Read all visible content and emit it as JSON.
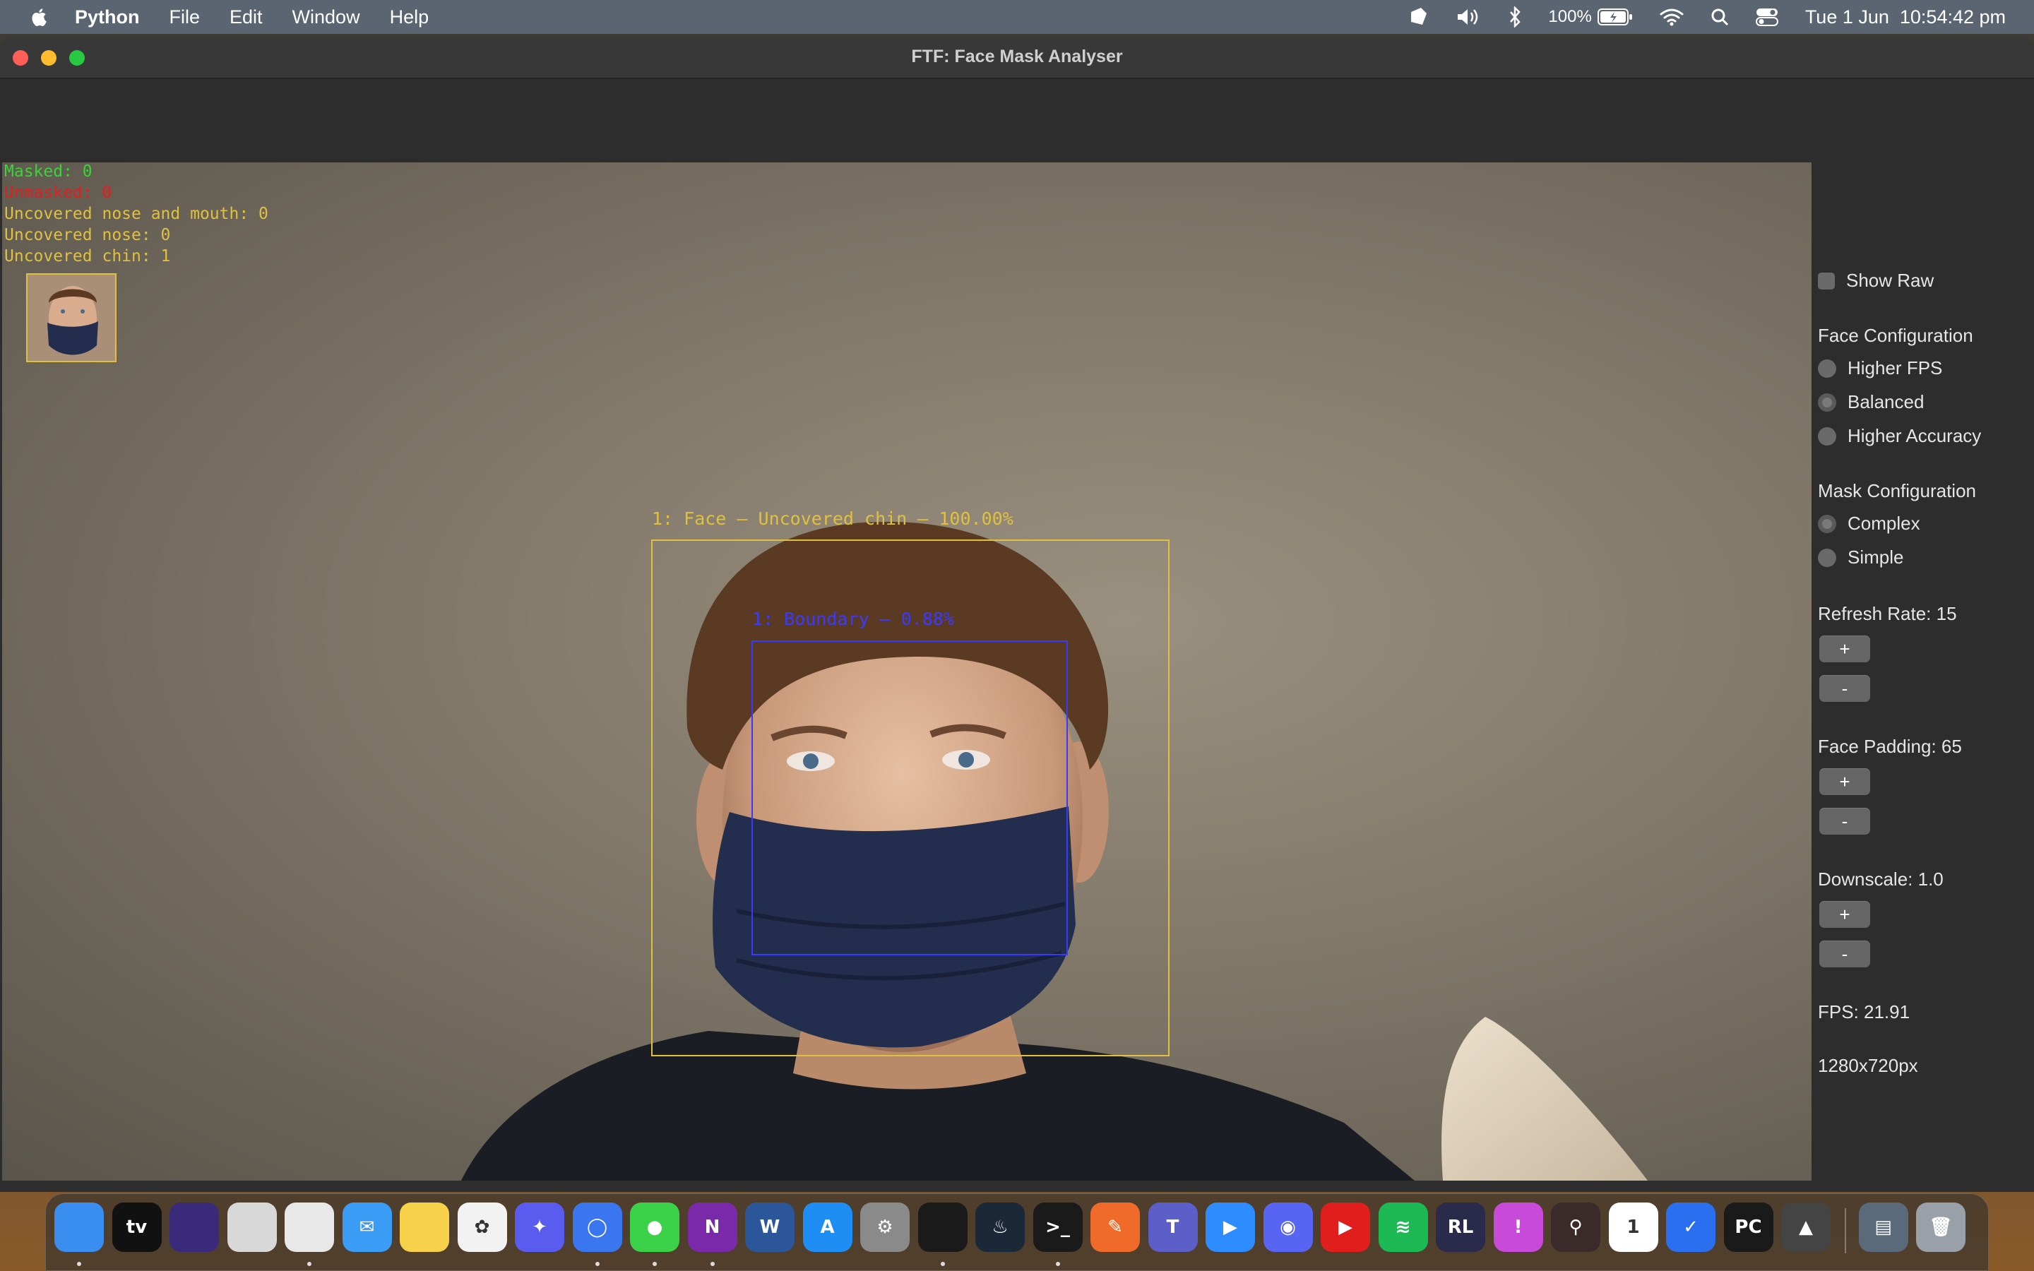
{
  "menubar": {
    "app_name": "Python",
    "menus": [
      "File",
      "Edit",
      "Window",
      "Help"
    ],
    "battery": "100%",
    "clock": "Tue 1 Jun  10:54:42 pm"
  },
  "window": {
    "title": "FTF: Face Mask Analyser"
  },
  "overlay": {
    "masked": "Masked: 0",
    "unmasked": "Unmasked: 0",
    "uncovered_nose_mouth": "Uncovered nose and mouth: 0",
    "uncovered_nose": "Uncovered nose: 0",
    "uncovered_chin": "Uncovered chin: 1",
    "face_label": "1: Face — Uncovered chin — 100.00%",
    "boundary_label": "1: Boundary — 0.88%",
    "colors": {
      "masked": "#3bd23b",
      "unmasked": "#e02020",
      "warning": "#e0c040",
      "boundary": "#3a3aff"
    }
  },
  "panel": {
    "show_raw": "Show Raw",
    "face_config_title": "Face Configuration",
    "face_options": [
      "Higher FPS",
      "Balanced",
      "Higher Accuracy"
    ],
    "face_selected": "Balanced",
    "mask_config_title": "Mask Configuration",
    "mask_options": [
      "Complex",
      "Simple"
    ],
    "mask_selected": "Complex",
    "refresh_rate": "Refresh Rate: 15",
    "face_padding": "Face Padding: 65",
    "downscale": "Downscale: 1.0",
    "plus": "+",
    "minus": "-",
    "fps": "FPS: 21.91",
    "resolution": "1280x720px"
  },
  "dock": {
    "apps": [
      {
        "name": "Finder",
        "color": "#3a8ef0",
        "glyph": ""
      },
      {
        "name": "TV",
        "color": "#111111",
        "glyph": "tv"
      },
      {
        "name": "Siri",
        "color": "#3a2a7a",
        "glyph": ""
      },
      {
        "name": "Launchpad",
        "color": "#d8d8d8",
        "glyph": ""
      },
      {
        "name": "Chrome",
        "color": "#e8e8e8",
        "glyph": ""
      },
      {
        "name": "Mail",
        "color": "#3a9cf5",
        "glyph": "✉"
      },
      {
        "name": "Notes",
        "color": "#f7d14a",
        "glyph": ""
      },
      {
        "name": "Photos",
        "color": "#f2f2f2",
        "glyph": "✿"
      },
      {
        "name": "Messenger",
        "color": "#5a5cf0",
        "glyph": "✦"
      },
      {
        "name": "Signal",
        "color": "#3a76f0",
        "glyph": "◯"
      },
      {
        "name": "Messages",
        "color": "#3bd24a",
        "glyph": "●"
      },
      {
        "name": "OneNote",
        "color": "#7a2aa8",
        "glyph": "N"
      },
      {
        "name": "Word",
        "color": "#2b579a",
        "glyph": "W"
      },
      {
        "name": "App Store",
        "color": "#1e8ef5",
        "glyph": "A"
      },
      {
        "name": "System Preferences",
        "color": "#8a8a8a",
        "glyph": "⚙"
      },
      {
        "name": "Python",
        "color": "#1a1a1a",
        "glyph": ""
      },
      {
        "name": "Steam",
        "color": "#1b2838",
        "glyph": "♨"
      },
      {
        "name": "Terminal",
        "color": "#1a1a1a",
        "glyph": ">_"
      },
      {
        "name": "Sketch",
        "color": "#f06a2a",
        "glyph": "✎"
      },
      {
        "name": "Teams",
        "color": "#5b5fc7",
        "glyph": "T"
      },
      {
        "name": "Zoom",
        "color": "#2d8cff",
        "glyph": "▶"
      },
      {
        "name": "Discord",
        "color": "#5865f2",
        "glyph": "◉"
      },
      {
        "name": "YouTube Music",
        "color": "#e01e1e",
        "glyph": "▶"
      },
      {
        "name": "Spotify",
        "color": "#1db954",
        "glyph": "≋"
      },
      {
        "name": "Rocket League",
        "color": "#2a2a4a",
        "glyph": "RL"
      },
      {
        "name": "Speeko",
        "color": "#c84ad8",
        "glyph": "!"
      },
      {
        "name": "Git Graph",
        "color": "#3a2a2a",
        "glyph": "⚲"
      },
      {
        "name": "Calendar",
        "color": "#ffffff",
        "glyph": "1"
      },
      {
        "name": "Tasks",
        "color": "#2a6ff0",
        "glyph": "✓"
      },
      {
        "name": "PyCharm",
        "color": "#1a1a1a",
        "glyph": "PC"
      },
      {
        "name": "Rocket",
        "color": "#444444",
        "glyph": "▲"
      },
      {
        "name": "Downloads",
        "color": "#5a6a7a",
        "glyph": "▤"
      },
      {
        "name": "Trash",
        "color": "#9aa0a8",
        "glyph": "🗑"
      }
    ]
  }
}
